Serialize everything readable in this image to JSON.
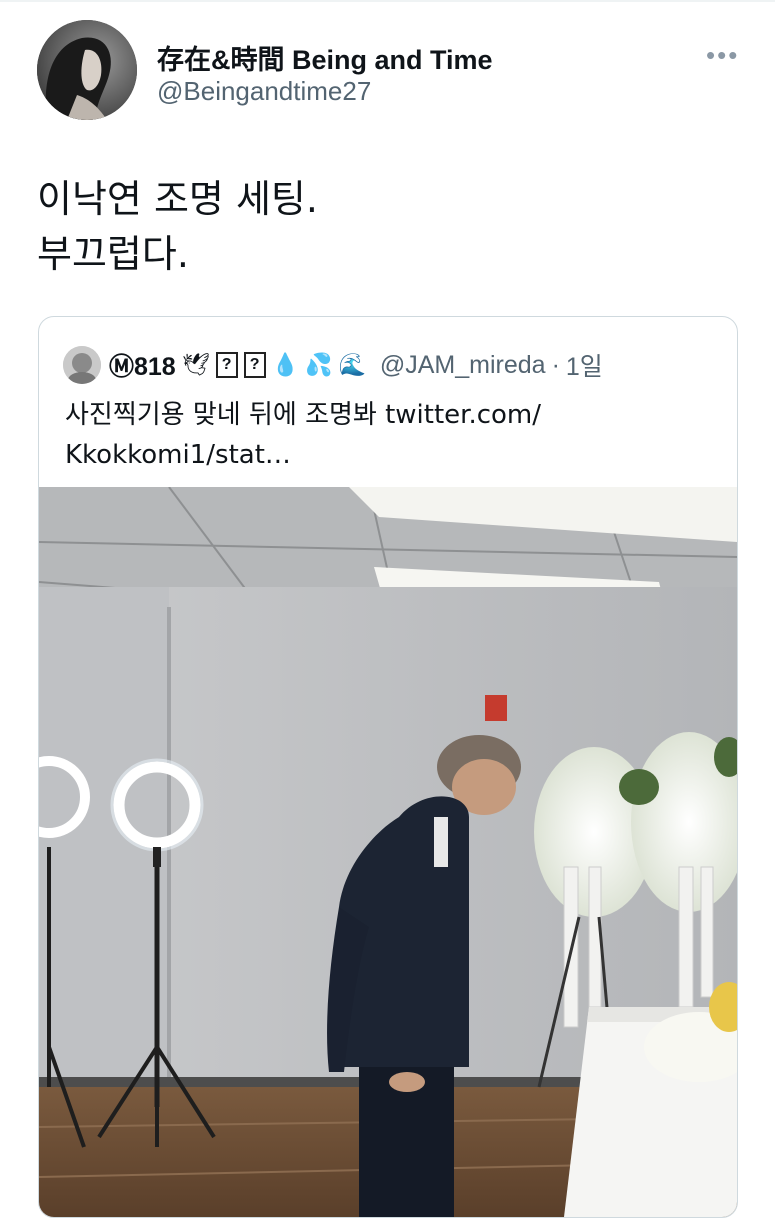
{
  "author": {
    "display_name": "存在&時間 Being and Time",
    "handle": "@Beingandtime27"
  },
  "more_icon": "more-icon",
  "tweet": {
    "line1": "이낙연 조명 세팅.",
    "line2": "부끄럽다."
  },
  "quoted": {
    "name": "Ⓜ818",
    "box1": "?",
    "box2": "?",
    "handle": "@JAM_mireda",
    "separator": "·",
    "time": "1일",
    "text_line1": "사진찍기용 맞네 뒤에 조명봐 twitter.com/",
    "text_line2": "Kkokkomi1/stat…"
  },
  "colors": {
    "text": "#0f1419",
    "secondary": "#536471",
    "border": "#cfd9de"
  }
}
